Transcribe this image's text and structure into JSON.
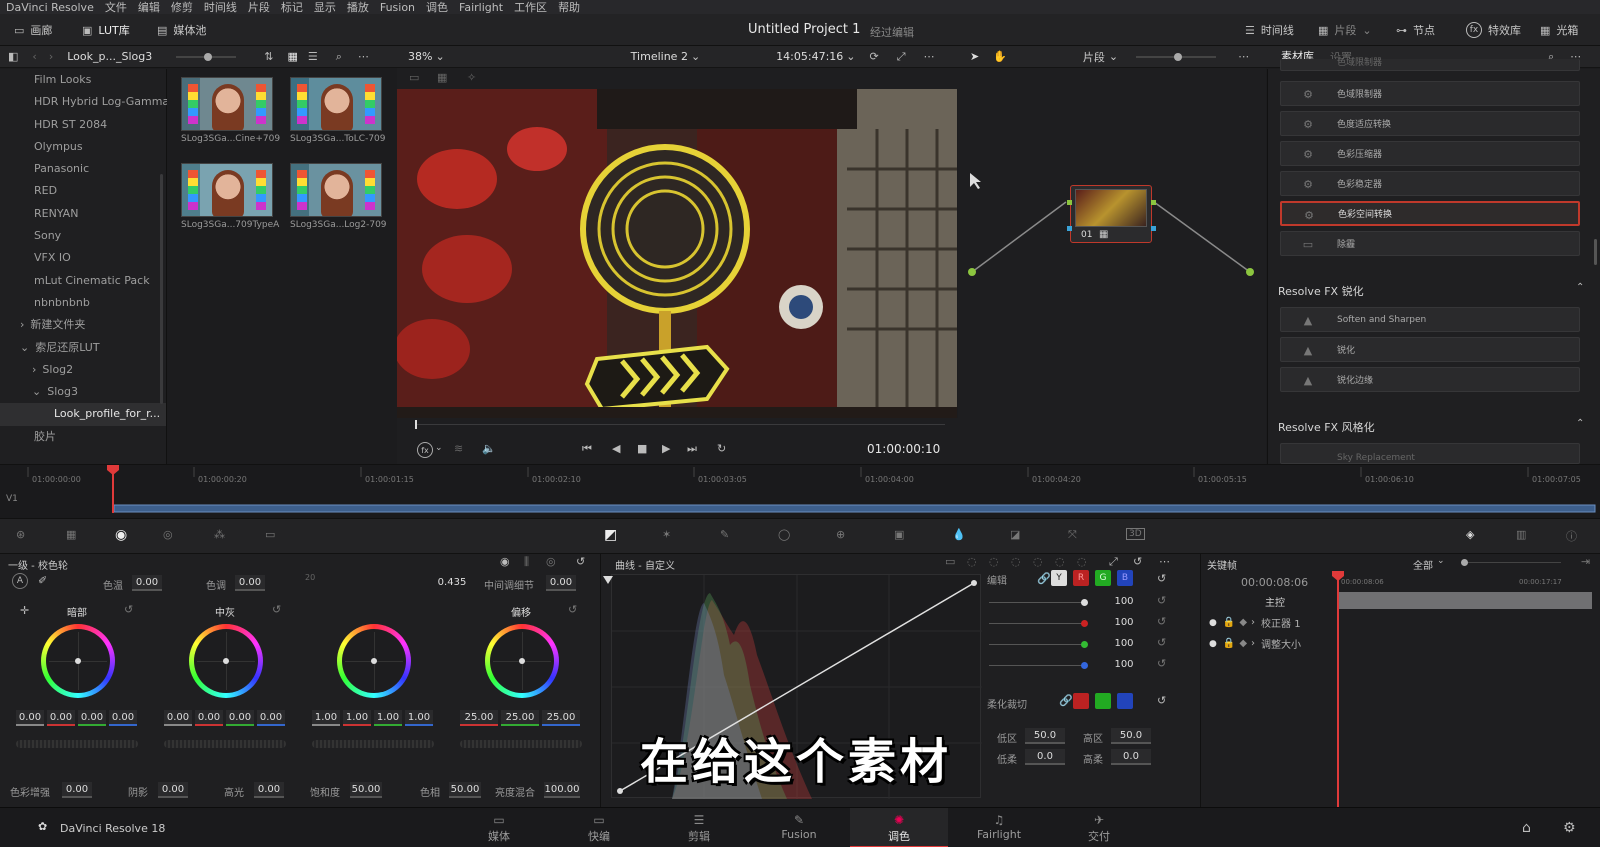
{
  "menubar": {
    "app": "DaVinci Resolve",
    "items": [
      "文件",
      "编辑",
      "修剪",
      "时间线",
      "片段",
      "标记",
      "显示",
      "播放",
      "Fusion",
      "调色",
      "Fairlight",
      "工作区",
      "帮助"
    ]
  },
  "toolbar": {
    "gallery": "画廊",
    "lut": "LUT库",
    "media_pool": "媒体池",
    "project_title": "Untitled Project 1",
    "project_status": "经过编辑",
    "timeline": "时间线",
    "clips": "片段",
    "nodes": "节点",
    "effects": "特效库",
    "light_box": "光箱"
  },
  "browser": {
    "path": "Look_p..._Slog3",
    "tree": [
      {
        "label": "Film Looks"
      },
      {
        "label": "HDR Hybrid Log-Gamma"
      },
      {
        "label": "HDR ST 2084"
      },
      {
        "label": "Olympus"
      },
      {
        "label": "Panasonic"
      },
      {
        "label": "RED"
      },
      {
        "label": "RENYAN"
      },
      {
        "label": "Sony"
      },
      {
        "label": "VFX IO"
      },
      {
        "label": "mLut Cinematic Pack"
      },
      {
        "label": "nbnbnbnb"
      },
      {
        "label": "新建文件夹"
      },
      {
        "label": "索尼还原LUT"
      },
      {
        "label": "Slog2"
      },
      {
        "label": "Slog3"
      },
      {
        "label": "Look_profile_for_r..."
      },
      {
        "label": "胶片"
      }
    ],
    "thumbs": [
      "SLog3SGa...Cine+709",
      "SLog3SGa...ToLC-709",
      "SLog3SGa...709TypeA",
      "SLog3SGa...Log2-709"
    ]
  },
  "viewer": {
    "zoom": "38%",
    "timeline": "Timeline 2",
    "timecode": "14:05:47:16",
    "playhead_tc": "01:00:00:10"
  },
  "nodes": {
    "mode": "片段",
    "node_label": "01"
  },
  "library": {
    "tab_library": "素材库",
    "tab_settings": "设置",
    "items_a": [
      "色域限制器",
      "色度适应转换",
      "色彩压缩器",
      "色彩稳定器",
      "色彩空间转换",
      "除霾"
    ],
    "section_sharpen": "Resolve FX 锐化",
    "items_b": [
      "Soften and Sharpen",
      "锐化",
      "锐化边缘"
    ],
    "section_stylize": "Resolve FX 风格化",
    "items_c": [
      "Sky Replacement"
    ]
  },
  "timeline": {
    "track": "V1",
    "ticks": [
      "01:00:00:00",
      "01:00:00:20",
      "01:00:01:15",
      "01:00:02:10",
      "01:00:03:05",
      "01:00:04:00",
      "01:00:04:20",
      "01:00:05:15",
      "01:00:06:10",
      "01:00:07:05"
    ]
  },
  "primaries": {
    "title": "一级 - 校色轮",
    "temp_label": "色温",
    "temp": "0.00",
    "tint_label": "色调",
    "tint": "0.00",
    "contrast": "0.435",
    "mid_detail_label": "中间调细节",
    "mid_detail": "0.00",
    "misc_label": "20",
    "wheels": [
      {
        "name": "暗部",
        "values": [
          "0.00",
          "0.00",
          "0.00",
          "0.00"
        ]
      },
      {
        "name": "中灰",
        "values": [
          "0.00",
          "0.00",
          "0.00",
          "0.00"
        ]
      },
      {
        "name": "",
        "values": [
          "1.00",
          "1.00",
          "1.00",
          "1.00"
        ]
      },
      {
        "name": "偏移",
        "values": [
          "25.00",
          "25.00",
          "25.00"
        ]
      }
    ],
    "bottom": [
      {
        "label": "色彩增强",
        "value": "0.00"
      },
      {
        "label": "阴影",
        "value": "0.00"
      },
      {
        "label": "高光",
        "value": "0.00"
      },
      {
        "label": "饱和度",
        "value": "50.00"
      },
      {
        "label": "色相",
        "value": "50.00"
      },
      {
        "label": "亮度混合",
        "value": "100.00"
      }
    ]
  },
  "curves": {
    "title": "曲线 - 自定义",
    "edit_label": "编辑",
    "channels": [
      "Y",
      "R",
      "G",
      "B"
    ],
    "intensity": [
      "100",
      "100",
      "100",
      "100"
    ],
    "soft_clip_label": "柔化裁切",
    "low_label": "低区",
    "low": "50.0",
    "high_label": "高区",
    "high": "50.0",
    "low_soft_label": "低柔",
    "low_soft": "0.0",
    "high_soft_label": "高柔",
    "high_soft": "0.0"
  },
  "keyframes": {
    "title": "关键帧",
    "filter": "全部",
    "tc": "00:00:08:06",
    "tc_a": "00:00:08:06",
    "tc_b": "00:00:17:17",
    "master": "主控",
    "rows": [
      "校正器 1",
      "调整大小"
    ]
  },
  "subtitle": "在给这个素材",
  "pages": {
    "version": "DaVinci Resolve 18",
    "tabs": [
      "媒体",
      "快编",
      "剪辑",
      "Fusion",
      "调色",
      "Fairlight",
      "交付"
    ],
    "active": 4
  },
  "colors": {
    "accent_red": "#e03a3a",
    "highlight_border": "#c0392b",
    "node_green": "#8cc63f"
  }
}
